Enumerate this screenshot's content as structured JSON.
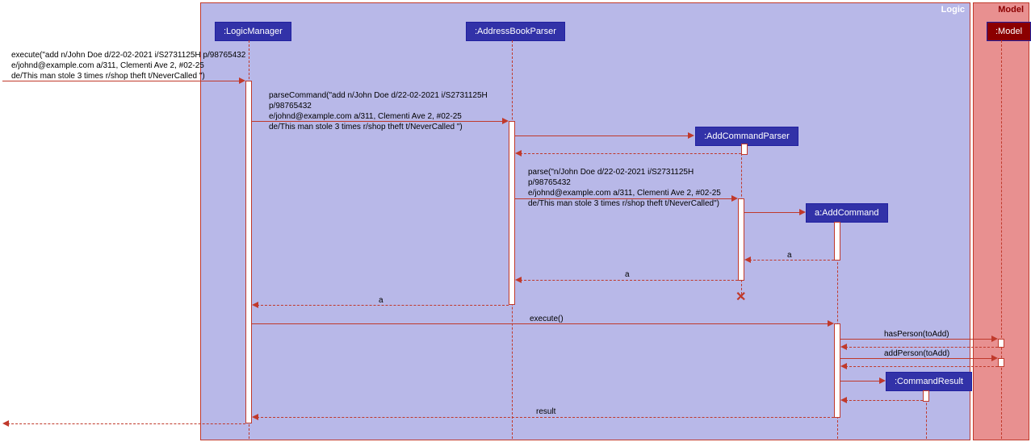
{
  "frames": {
    "logic": "Logic",
    "model": "Model"
  },
  "participants": {
    "logicManager": ":LogicManager",
    "addressBookParser": ":AddressBookParser",
    "addCommandParser": ":AddCommandParser",
    "addCommand": "a:AddCommand",
    "commandResult": ":CommandResult",
    "model": ":Model"
  },
  "messages": {
    "execute1_l1": "execute(\"add n/John Doe d/22-02-2021 i/S2731125H p/98765432",
    "execute1_l2": "e/johnd@example.com a/311, Clementi Ave 2, #02-25",
    "execute1_l3": "de/This man stole 3 times r/shop theft t/NeverCalled \")",
    "parseCommand_l1": "parseCommand(\"add n/John Doe d/22-02-2021 i/S2731125H p/98765432",
    "parseCommand_l2": "e/johnd@example.com a/311, Clementi Ave 2, #02-25",
    "parseCommand_l3": "de/This man stole 3 times r/shop theft t/NeverCalled \")",
    "parse_l1": "parse(\"n/John Doe d/22-02-2021 i/S2731125H p/98765432",
    "parse_l2": "e/johnd@example.com a/311, Clementi Ave 2, #02-25",
    "parse_l3": "de/This man stole 3 times r/shop theft t/NeverCalled\")",
    "return_a": "a",
    "execute2": "execute()",
    "hasPerson": "hasPerson(toAdd)",
    "addPerson": "addPerson(toAdd)",
    "result": "result"
  }
}
